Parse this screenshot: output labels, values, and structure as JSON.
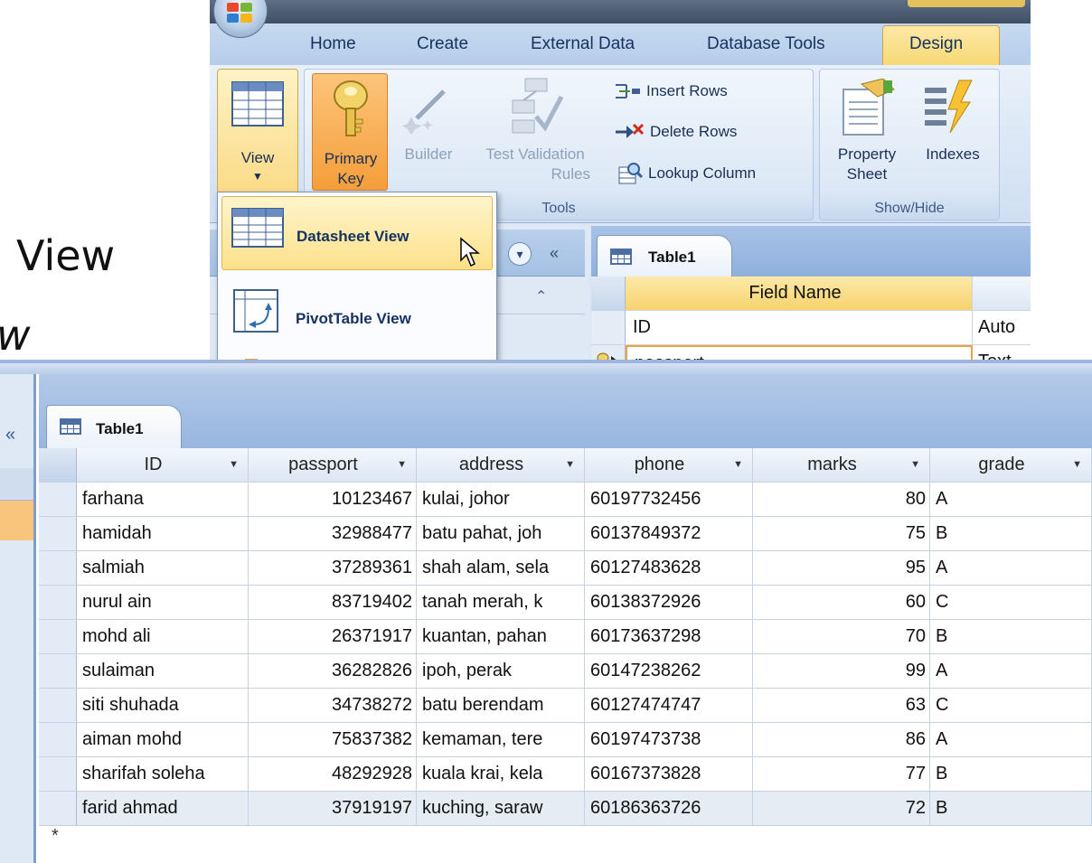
{
  "slide": {
    "line1": "View",
    "line2": "w"
  },
  "ribbon": {
    "tabs": [
      "Home",
      "Create",
      "External Data",
      "Database Tools",
      "Design"
    ],
    "view_label": "View",
    "primary_key_label_1": "Primary",
    "primary_key_label_2": "Key",
    "builder_label": "Builder",
    "test_validation_label_1": "Test Validation",
    "test_validation_label_2": "Rules",
    "insert_rows_label": "Insert Rows",
    "delete_rows_label": "Delete Rows",
    "lookup_column_label": "Lookup Column",
    "tools_group_label": "Tools",
    "property_sheet_label_1": "Property",
    "property_sheet_label_2": "Sheet",
    "indexes_label": "Indexes",
    "show_hide_group_label": "Show/Hide"
  },
  "view_menu": {
    "datasheet_view": "Datasheet View",
    "pivottable_view": "PivotTable View"
  },
  "design_view": {
    "tab_label": "Table1",
    "field_name_header": "Field Name",
    "rows": [
      {
        "field": "ID",
        "type": "Auto"
      },
      {
        "field": "passport",
        "type": "Text"
      }
    ]
  },
  "datasheet": {
    "tab_label": "Table1",
    "columns": [
      "ID",
      "passport",
      "address",
      "phone",
      "marks",
      "grade"
    ],
    "rows": [
      {
        "id": "farhana",
        "passport": "10123467",
        "address": "kulai, johor",
        "phone": "60197732456",
        "marks": "80",
        "grade": "A"
      },
      {
        "id": "hamidah",
        "passport": "32988477",
        "address": "batu pahat, joh",
        "phone": "60137849372",
        "marks": "75",
        "grade": "B"
      },
      {
        "id": "salmiah",
        "passport": "37289361",
        "address": "shah alam, sela",
        "phone": "60127483628",
        "marks": "95",
        "grade": "A"
      },
      {
        "id": "nurul ain",
        "passport": "83719402",
        "address": "tanah merah, k",
        "phone": "60138372926",
        "marks": "60",
        "grade": "C"
      },
      {
        "id": "mohd ali",
        "passport": "26371917",
        "address": "kuantan, pahan",
        "phone": "60173637298",
        "marks": "70",
        "grade": "B"
      },
      {
        "id": "sulaiman",
        "passport": "36282826",
        "address": "ipoh, perak",
        "phone": "60147238262",
        "marks": "99",
        "grade": "A"
      },
      {
        "id": "siti shuhada",
        "passport": "34738272",
        "address": "batu berendam",
        "phone": "60127474747",
        "marks": "63",
        "grade": "C"
      },
      {
        "id": "aiman mohd",
        "passport": "75837382",
        "address": "kemaman, tere",
        "phone": "60197473738",
        "marks": "86",
        "grade": "A"
      },
      {
        "id": "sharifah soleha",
        "passport": "48292928",
        "address": "kuala krai, kela",
        "phone": "60167373828",
        "marks": "77",
        "grade": "B"
      },
      {
        "id": "farid ahmad",
        "passport": "37919197",
        "address": "kuching, saraw",
        "phone": "60186363726",
        "marks": "72",
        "grade": "B"
      }
    ],
    "new_row_marker": "*"
  }
}
